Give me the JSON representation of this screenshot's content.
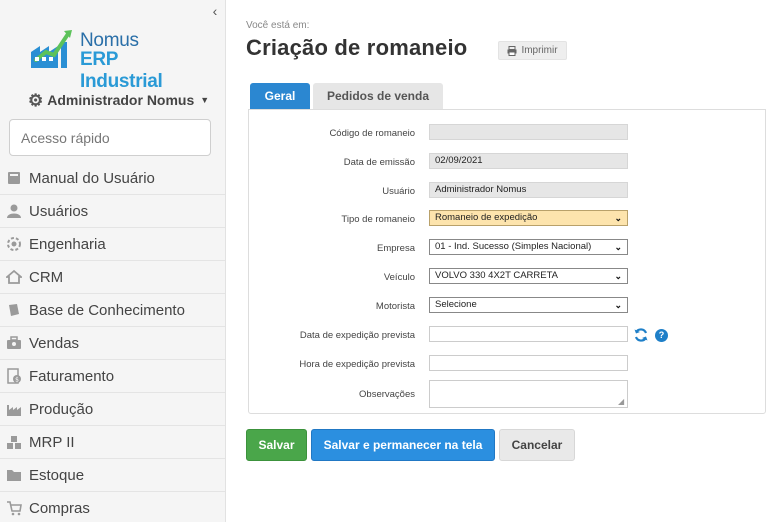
{
  "sidebar": {
    "brand_line1": "Nomus",
    "brand_line2": "ERP Industrial",
    "user_name": "Administrador Nomus",
    "quick_access_placeholder": "Acesso rápido",
    "items": [
      {
        "label": "Manual do Usuário",
        "icon": "book-icon"
      },
      {
        "label": "Usuários",
        "icon": "user-icon"
      },
      {
        "label": "Engenharia",
        "icon": "gear-icon"
      },
      {
        "label": "CRM",
        "icon": "home-icon"
      },
      {
        "label": "Base de Conhecimento",
        "icon": "notebook-icon"
      },
      {
        "label": "Vendas",
        "icon": "briefcase-icon"
      },
      {
        "label": "Faturamento",
        "icon": "invoice-icon"
      },
      {
        "label": "Produção",
        "icon": "factory-icon"
      },
      {
        "label": "MRP II",
        "icon": "boxes-icon"
      },
      {
        "label": "Estoque",
        "icon": "folder-icon"
      },
      {
        "label": "Compras",
        "icon": "cart-icon"
      }
    ]
  },
  "main": {
    "breadcrumb": "Você está em:",
    "title": "Criação de romaneio",
    "print_label": "Imprimir",
    "tabs": [
      {
        "label": "Geral",
        "active": true
      },
      {
        "label": "Pedidos de venda",
        "active": false
      }
    ],
    "form": {
      "codigo_label": "Código de romaneio",
      "codigo_value": "",
      "data_emissao_label": "Data de emissão",
      "data_emissao_value": "02/09/2021",
      "usuario_label": "Usuário",
      "usuario_value": "Administrador Nomus",
      "tipo_label": "Tipo de romaneio",
      "tipo_value": "Romaneio de expedição",
      "empresa_label": "Empresa",
      "empresa_value": "01 - Ind. Sucesso (Simples Nacional)",
      "veiculo_label": "Veículo",
      "veiculo_value": "VOLVO 330 4X2T CARRETA",
      "motorista_label": "Motorista",
      "motorista_value": "Selecione",
      "data_expedicao_label": "Data de expedição prevista",
      "data_expedicao_value": "",
      "hora_expedicao_label": "Hora de expedição prevista",
      "hora_expedicao_value": "",
      "observacoes_label": "Observações",
      "observacoes_value": "",
      "help_glyph": "?"
    },
    "actions": {
      "save": "Salvar",
      "save_stay": "Salvar e permanecer na tela",
      "cancel": "Cancelar"
    }
  },
  "colors": {
    "accent": "#2b87d1",
    "save": "#4aa64a",
    "highlight_select": "#fde4ad"
  }
}
